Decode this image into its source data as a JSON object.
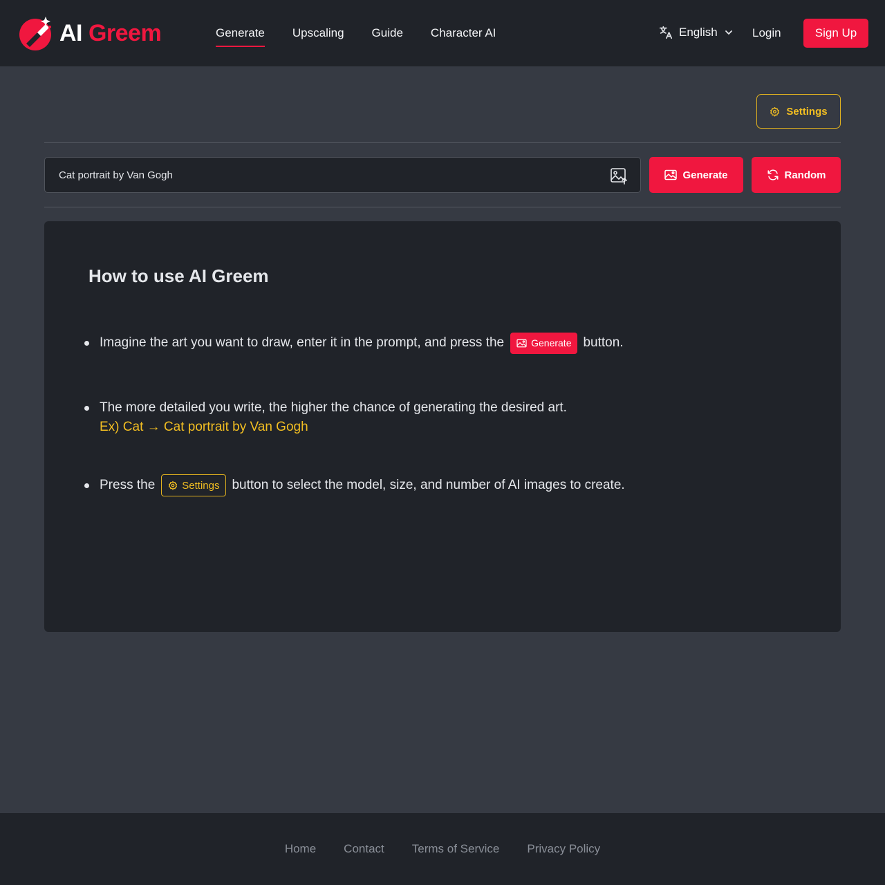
{
  "brand": {
    "prefix": "AI",
    "name": "Greem"
  },
  "nav": {
    "items": [
      {
        "label": "Generate",
        "active": true
      },
      {
        "label": "Upscaling",
        "active": false
      },
      {
        "label": "Guide",
        "active": false
      },
      {
        "label": "Character AI",
        "active": false
      }
    ]
  },
  "header": {
    "language": "English",
    "login": "Login",
    "signup": "Sign Up"
  },
  "toolbar": {
    "settings_label": "Settings"
  },
  "prompt": {
    "value": "Cat portrait by Van Gogh",
    "generate_label": "Generate",
    "random_label": "Random"
  },
  "guide": {
    "title": "How to use AI Greem",
    "step1_before": "Imagine the art you want to draw, enter it in the prompt, and press the",
    "step1_chip": "Generate",
    "step1_after": "button.",
    "step2_text": "The more detailed you write, the higher the chance of generating the desired art.",
    "step2_example": "Ex) Cat → Cat portrait by Van Gogh",
    "step3_before": "Press the",
    "step3_chip": "Settings",
    "step3_after": "button to select the model, size, and number of AI images to create."
  },
  "footer": {
    "links": [
      "Home",
      "Contact",
      "Terms of Service",
      "Privacy Policy"
    ]
  },
  "colors": {
    "accent": "#f0173f",
    "highlight": "#f2be22",
    "panel": "#202329",
    "background": "#363a43"
  },
  "icons": [
    "brush-logo-icon",
    "translate-icon",
    "chevron-down-icon",
    "gear-icon",
    "image-upload-icon",
    "image-icon",
    "refresh-icon"
  ]
}
